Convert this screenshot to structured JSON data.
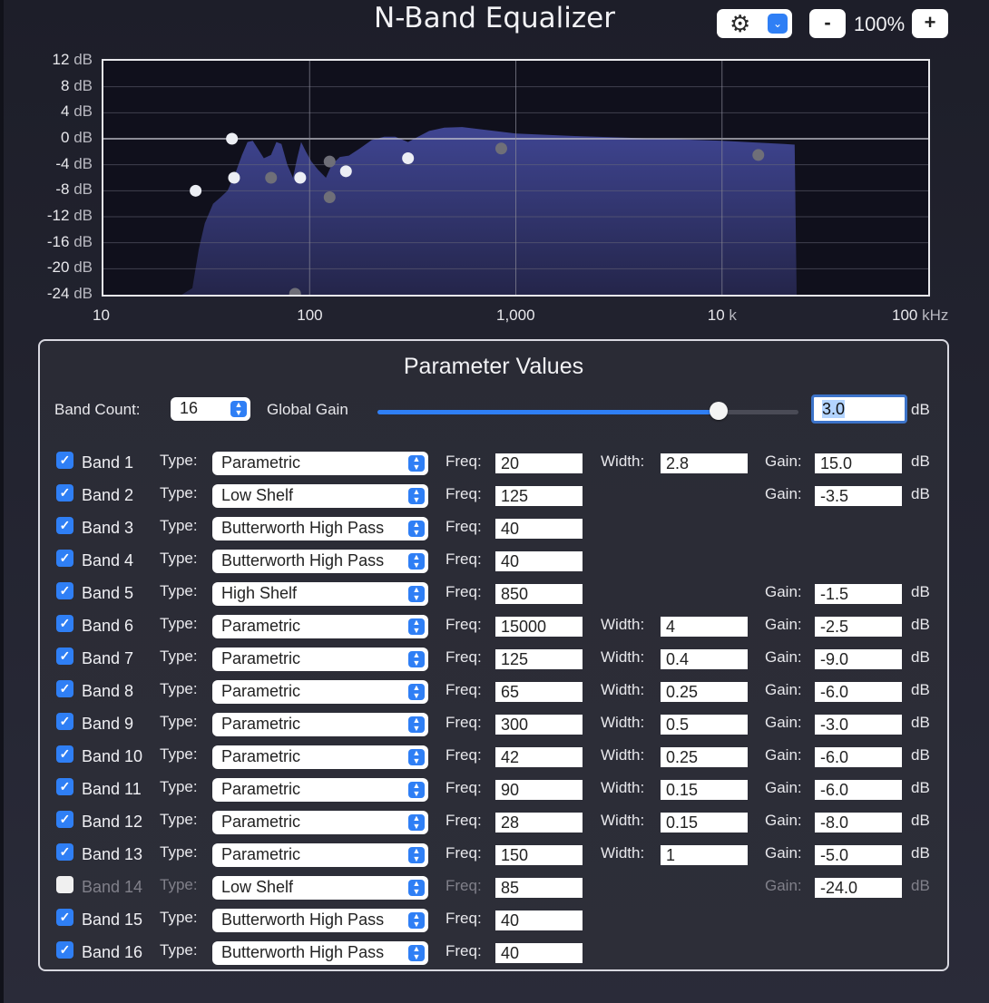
{
  "window": {
    "title": "N-Band Equalizer"
  },
  "toolbar": {
    "settings_icon": "gear-icon",
    "zoom_minus": "-",
    "zoom_value": "100%",
    "zoom_plus": "+"
  },
  "graph": {
    "y_ticks": [
      {
        "value": "12",
        "unit": "dB"
      },
      {
        "value": "8",
        "unit": "dB"
      },
      {
        "value": "4",
        "unit": "dB"
      },
      {
        "value": "0",
        "unit": "dB"
      },
      {
        "value": "-4",
        "unit": "dB"
      },
      {
        "value": "-8",
        "unit": "dB"
      },
      {
        "value": "-12",
        "unit": "dB"
      },
      {
        "value": "-16",
        "unit": "dB"
      },
      {
        "value": "-20",
        "unit": "dB"
      },
      {
        "value": "-24",
        "unit": "dB"
      }
    ],
    "x_ticks": [
      {
        "value": "10",
        "unit": ""
      },
      {
        "value": "100",
        "unit": ""
      },
      {
        "value": "1,000",
        "unit": ""
      },
      {
        "value": "10",
        "unit": "k"
      },
      {
        "value": "100",
        "unit": "kHz"
      }
    ],
    "x_range_hz": [
      10,
      100000
    ],
    "y_range_db": [
      -24,
      12
    ],
    "x_scale": "log",
    "grid": true,
    "fill_color": "#3f4592",
    "response_curve": [
      [
        24,
        -24
      ],
      [
        27,
        -23
      ],
      [
        29,
        -17
      ],
      [
        31,
        -13
      ],
      [
        34,
        -10
      ],
      [
        37,
        -9
      ],
      [
        40,
        -8
      ],
      [
        44,
        -5
      ],
      [
        47,
        -2.5
      ],
      [
        50,
        -0.5
      ],
      [
        53,
        -0.3
      ],
      [
        56,
        -1.5
      ],
      [
        60,
        -3
      ],
      [
        65,
        -2.5
      ],
      [
        69,
        -0.5
      ],
      [
        73,
        -0.8
      ],
      [
        78,
        -4
      ],
      [
        83,
        -6
      ],
      [
        87,
        -3
      ],
      [
        91,
        -0.5
      ],
      [
        96,
        -2
      ],
      [
        102,
        -3.5
      ],
      [
        110,
        -4.8
      ],
      [
        120,
        -6
      ],
      [
        128,
        -4
      ],
      [
        140,
        -2.8
      ],
      [
        155,
        -2.6
      ],
      [
        175,
        -1.5
      ],
      [
        200,
        -0.2
      ],
      [
        230,
        0.3
      ],
      [
        260,
        0.3
      ],
      [
        300,
        -0.5
      ],
      [
        330,
        0.2
      ],
      [
        380,
        1.2
      ],
      [
        450,
        1.7
      ],
      [
        550,
        1.8
      ],
      [
        700,
        1.4
      ],
      [
        1000,
        0.8
      ],
      [
        2000,
        0.4
      ],
      [
        5000,
        0
      ],
      [
        10000,
        -0.3
      ],
      [
        20000,
        -0.8
      ],
      [
        22500,
        -0.9
      ],
      [
        23000,
        -24
      ]
    ],
    "points_enabled": [
      {
        "freq": 28,
        "gain": -8.0
      },
      {
        "freq": 42,
        "gain": 0.0
      },
      {
        "freq": 43,
        "gain": -6.0
      },
      {
        "freq": 90,
        "gain": -6.0
      },
      {
        "freq": 150,
        "gain": -5.0
      },
      {
        "freq": 300,
        "gain": -3.0
      }
    ],
    "points_dimmed": [
      {
        "freq": 65,
        "gain": -6.0
      },
      {
        "freq": 125,
        "gain": -3.5
      },
      {
        "freq": 125,
        "gain": -9.0
      },
      {
        "freq": 850,
        "gain": -1.5
      },
      {
        "freq": 15000,
        "gain": -2.5
      },
      {
        "freq": 85,
        "gain": -24.0
      }
    ]
  },
  "panel": {
    "title": "Parameter Values",
    "band_count_label": "Band Count:",
    "band_count_value": "16",
    "global_gain_label": "Global Gain",
    "global_gain_fraction": 0.81,
    "global_gain_value": "3.0",
    "global_gain_unit": "dB",
    "labels": {
      "type": "Type:",
      "freq": "Freq:",
      "width": "Width:",
      "gain": "Gain:",
      "db": "dB"
    },
    "bands": [
      {
        "name": "Band 1",
        "enabled": true,
        "type": "Parametric",
        "freq": "20",
        "width": "2.8",
        "gain": "15.0"
      },
      {
        "name": "Band 2",
        "enabled": true,
        "type": "Low Shelf",
        "freq": "125",
        "width": null,
        "gain": "-3.5"
      },
      {
        "name": "Band 3",
        "enabled": true,
        "type": "Butterworth High Pass",
        "freq": "40",
        "width": null,
        "gain": null
      },
      {
        "name": "Band 4",
        "enabled": true,
        "type": "Butterworth High Pass",
        "freq": "40",
        "width": null,
        "gain": null
      },
      {
        "name": "Band 5",
        "enabled": true,
        "type": "High Shelf",
        "freq": "850",
        "width": null,
        "gain": "-1.5"
      },
      {
        "name": "Band 6",
        "enabled": true,
        "type": "Parametric",
        "freq": "15000",
        "width": "4",
        "gain": "-2.5"
      },
      {
        "name": "Band 7",
        "enabled": true,
        "type": "Parametric",
        "freq": "125",
        "width": "0.4",
        "gain": "-9.0"
      },
      {
        "name": "Band 8",
        "enabled": true,
        "type": "Parametric",
        "freq": "65",
        "width": "0.25",
        "gain": "-6.0"
      },
      {
        "name": "Band 9",
        "enabled": true,
        "type": "Parametric",
        "freq": "300",
        "width": "0.5",
        "gain": "-3.0"
      },
      {
        "name": "Band 10",
        "enabled": true,
        "type": "Parametric",
        "freq": "42",
        "width": "0.25",
        "gain": "-6.0"
      },
      {
        "name": "Band 11",
        "enabled": true,
        "type": "Parametric",
        "freq": "90",
        "width": "0.15",
        "gain": "-6.0"
      },
      {
        "name": "Band 12",
        "enabled": true,
        "type": "Parametric",
        "freq": "28",
        "width": "0.15",
        "gain": "-8.0"
      },
      {
        "name": "Band 13",
        "enabled": true,
        "type": "Parametric",
        "freq": "150",
        "width": "1",
        "gain": "-5.0"
      },
      {
        "name": "Band 14",
        "enabled": false,
        "type": "Low Shelf",
        "freq": "85",
        "width": null,
        "gain": "-24.0"
      },
      {
        "name": "Band 15",
        "enabled": true,
        "type": "Butterworth High Pass",
        "freq": "40",
        "width": null,
        "gain": null
      },
      {
        "name": "Band 16",
        "enabled": true,
        "type": "Butterworth High Pass",
        "freq": "40",
        "width": null,
        "gain": null
      }
    ]
  }
}
